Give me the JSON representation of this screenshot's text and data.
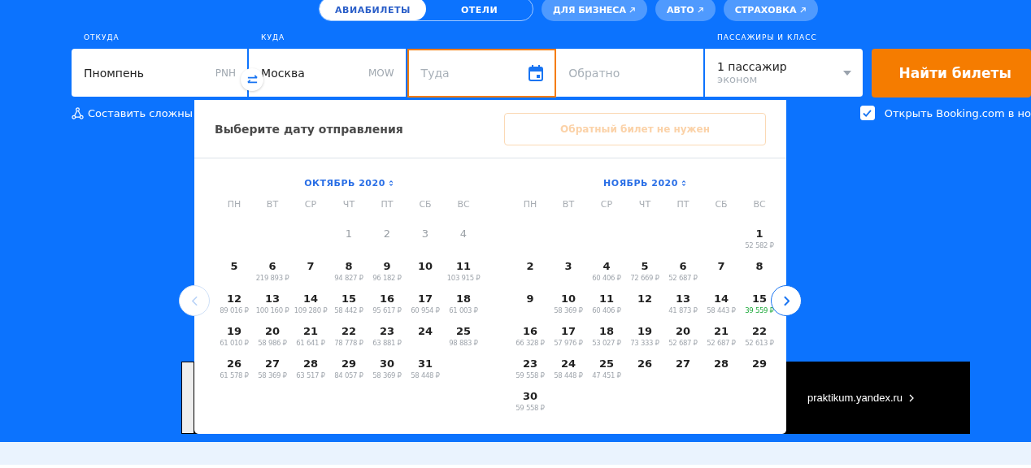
{
  "nav": {
    "tabs": [
      {
        "label": "АВИАБИЛЕТЫ",
        "selected": true
      },
      {
        "label": "ОТЕЛИ",
        "selected": false
      }
    ],
    "links": [
      "ДЛЯ БИЗНЕСА",
      "АВТО",
      "СТРАХОВКА"
    ]
  },
  "search": {
    "from": {
      "label": "ОТКУДА",
      "value": "Пномпень",
      "code": "PNH"
    },
    "to": {
      "label": "КУДА",
      "value": "Москва",
      "code": "MOW"
    },
    "depart": {
      "placeholder": "Туда",
      "focused": true
    },
    "return": {
      "placeholder": "Обратно",
      "focused": false
    },
    "passengers": {
      "label": "ПАССАЖИРЫ И КЛАСС",
      "value": "1 пассажир",
      "class": "эконом"
    },
    "submit": "Найти билеты"
  },
  "complex_route_link": "Составить сложны",
  "booking": {
    "label": "Открыть Booking.com в но",
    "checked": true
  },
  "banner": {
    "link": "praktikum.yandex.ru"
  },
  "datepicker": {
    "title": "Выберите дату отправления",
    "no_return_button": "Обратный билет не нужен",
    "prev_disabled": true,
    "months": [
      {
        "title": "ОКТЯБРЬ 2020",
        "weekdays": [
          "ПН",
          "ВТ",
          "СР",
          "ЧТ",
          "ПТ",
          "СБ",
          "ВС"
        ],
        "weeks": [
          [
            {
              "day": "1",
              "disabled": true
            },
            {
              "day": "2",
              "disabled": true
            },
            {
              "day": "3",
              "disabled": true
            },
            {
              "day": "4",
              "disabled": true
            }
          ],
          [
            {
              "day": "5",
              "disabled": false
            },
            {
              "day": "6",
              "price": "219 893 ₽",
              "disabled": false,
              "best": false
            },
            {
              "day": "7",
              "disabled": false
            },
            {
              "day": "8",
              "price": "94 827 ₽",
              "disabled": false,
              "best": false
            },
            {
              "day": "9",
              "price": "96 182 ₽",
              "disabled": false,
              "best": false
            },
            {
              "day": "10",
              "disabled": false
            },
            {
              "day": "11",
              "price": "103 915 ₽",
              "disabled": false,
              "best": false
            }
          ],
          [
            {
              "day": "12",
              "price": "89 016 ₽",
              "disabled": false,
              "best": false
            },
            {
              "day": "13",
              "price": "100 160 ₽",
              "disabled": false,
              "best": false
            },
            {
              "day": "14",
              "price": "109 280 ₽",
              "disabled": false,
              "best": false
            },
            {
              "day": "15",
              "price": "58 442 ₽",
              "disabled": false,
              "best": false
            },
            {
              "day": "16",
              "price": "95 617 ₽",
              "disabled": false,
              "best": false
            },
            {
              "day": "17",
              "price": "60 954 ₽",
              "disabled": false,
              "best": false
            },
            {
              "day": "18",
              "price": "61 003 ₽",
              "disabled": false,
              "best": false
            }
          ],
          [
            {
              "day": "19",
              "price": "61 010 ₽",
              "disabled": false,
              "best": false
            },
            {
              "day": "20",
              "price": "58 986 ₽",
              "disabled": false,
              "best": false
            },
            {
              "day": "21",
              "price": "61 641 ₽",
              "disabled": false,
              "best": false
            },
            {
              "day": "22",
              "price": "78 778 ₽",
              "disabled": false,
              "best": false
            },
            {
              "day": "23",
              "price": "63 881 ₽",
              "disabled": false,
              "best": false
            },
            {
              "day": "24",
              "disabled": false
            },
            {
              "day": "25",
              "price": "98 883 ₽",
              "disabled": false,
              "best": false
            }
          ],
          [
            {
              "day": "26",
              "price": "61 578 ₽",
              "disabled": false,
              "best": false
            },
            {
              "day": "27",
              "price": "58 369 ₽",
              "disabled": false,
              "best": false
            },
            {
              "day": "28",
              "price": "63 517 ₽",
              "disabled": false,
              "best": false
            },
            {
              "day": "29",
              "price": "84 057 ₽",
              "disabled": false,
              "best": false
            },
            {
              "day": "30",
              "price": "58 369 ₽",
              "disabled": false,
              "best": false
            },
            {
              "day": "31",
              "price": "58 448 ₽",
              "disabled": false,
              "best": false
            }
          ]
        ]
      },
      {
        "title": "НОЯБРЬ 2020",
        "weekdays": [
          "ПН",
          "ВТ",
          "СР",
          "ЧТ",
          "ПТ",
          "СБ",
          "ВС"
        ],
        "weeks": [
          [
            {
              "day": "1",
              "price": "52 582 ₽",
              "disabled": false,
              "best": false
            }
          ],
          [
            {
              "day": "2",
              "disabled": false
            },
            {
              "day": "3",
              "disabled": false
            },
            {
              "day": "4",
              "price": "60 406 ₽",
              "disabled": false,
              "best": false
            },
            {
              "day": "5",
              "price": "72 669 ₽",
              "disabled": false,
              "best": false
            },
            {
              "day": "6",
              "price": "52 687 ₽",
              "disabled": false,
              "best": false
            },
            {
              "day": "7",
              "disabled": false
            },
            {
              "day": "8",
              "disabled": false
            }
          ],
          [
            {
              "day": "9",
              "disabled": false
            },
            {
              "day": "10",
              "price": "58 369 ₽",
              "disabled": false,
              "best": false
            },
            {
              "day": "11",
              "price": "60 406 ₽",
              "disabled": false,
              "best": false
            },
            {
              "day": "12",
              "disabled": false
            },
            {
              "day": "13",
              "price": "41 873 ₽",
              "disabled": false,
              "best": false
            },
            {
              "day": "14",
              "price": "58 443 ₽",
              "disabled": false,
              "best": false
            },
            {
              "day": "15",
              "price": "39 559 ₽",
              "disabled": false,
              "best": true
            }
          ],
          [
            {
              "day": "16",
              "price": "66 328 ₽",
              "disabled": false,
              "best": false
            },
            {
              "day": "17",
              "price": "57 976 ₽",
              "disabled": false,
              "best": false
            },
            {
              "day": "18",
              "price": "53 027 ₽",
              "disabled": false,
              "best": false
            },
            {
              "day": "19",
              "price": "73 333 ₽",
              "disabled": false,
              "best": false
            },
            {
              "day": "20",
              "price": "52 687 ₽",
              "disabled": false,
              "best": false
            },
            {
              "day": "21",
              "price": "52 687 ₽",
              "disabled": false,
              "best": false
            },
            {
              "day": "22",
              "price": "52 613 ₽",
              "disabled": false,
              "best": false
            }
          ],
          [
            {
              "day": "23",
              "price": "59 558 ₽",
              "disabled": false,
              "best": false
            },
            {
              "day": "24",
              "price": "58 448 ₽",
              "disabled": false,
              "best": false
            },
            {
              "day": "25",
              "price": "47 451 ₽",
              "disabled": false,
              "best": false
            },
            {
              "day": "26",
              "disabled": false
            },
            {
              "day": "27",
              "disabled": false
            },
            {
              "day": "28",
              "disabled": false
            },
            {
              "day": "29",
              "disabled": false
            }
          ],
          [
            {
              "day": "30",
              "price": "59 558 ₽",
              "disabled": false,
              "best": false
            }
          ]
        ]
      }
    ]
  }
}
